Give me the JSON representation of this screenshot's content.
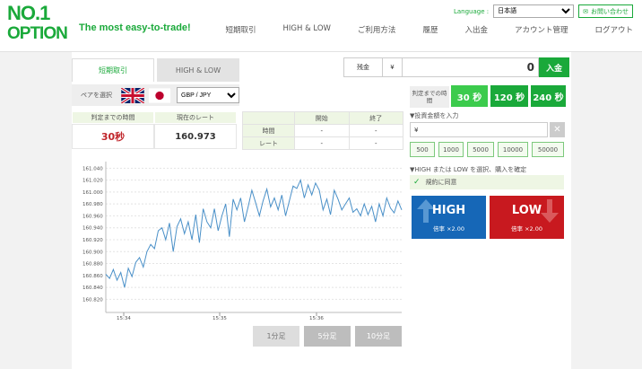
{
  "header": {
    "logo_line1": "NO.1",
    "logo_line2": "OPTION",
    "tagline": "The most easy-to-trade!",
    "language_label": "Language :",
    "language_value": "日本語",
    "contact_label": "お問い合わせ",
    "nav": [
      "短期取引",
      "HIGH & LOW",
      "ご利用方法",
      "履歴",
      "入出金",
      "アカウント管理",
      "ログアウト"
    ]
  },
  "tabs": {
    "short_term": "短期取引",
    "high_low": "HIGH & LOW"
  },
  "balance": {
    "label": "残金",
    "currency": "¥",
    "value": "0",
    "deposit_label": "入金"
  },
  "pair": {
    "label": "ペアを選択",
    "value": "GBP / JPY"
  },
  "stats": {
    "time_label": "判定までの時間",
    "rate_label": "現在のレート",
    "countdown": "30秒",
    "rate": "160.973"
  },
  "order_table": {
    "headers": [
      "",
      "開始",
      "終了"
    ],
    "rows": [
      [
        "時間",
        "-",
        "-"
      ],
      [
        "レート",
        "-",
        "-"
      ]
    ]
  },
  "chart_data": {
    "type": "line",
    "xlabel": "",
    "ylabel": "",
    "y_ticks": [
      "161.040",
      "161.020",
      "161.000",
      "160.980",
      "160.960",
      "160.940",
      "160.920",
      "160.900",
      "160.880",
      "160.860",
      "160.840",
      "160.820"
    ],
    "x_ticks": [
      "15:34",
      "15:35",
      "15:36"
    ],
    "ylim": [
      160.81,
      161.045
    ],
    "series": [
      {
        "values": [
          160.862,
          160.855,
          160.87,
          160.852,
          160.865,
          160.84,
          160.872,
          160.858,
          160.882,
          160.89,
          160.874,
          160.9,
          160.912,
          160.905,
          160.935,
          160.94,
          160.92,
          160.948,
          160.9,
          160.942,
          160.955,
          160.93,
          160.95,
          160.92,
          160.962,
          160.915,
          160.972,
          160.95,
          160.94,
          160.972,
          160.935,
          160.96,
          160.98,
          160.925,
          160.988,
          160.97,
          160.99,
          160.95,
          160.975,
          161.003,
          160.982,
          160.96,
          160.985,
          161.005,
          160.975,
          160.99,
          160.97,
          160.995,
          160.96,
          160.985,
          161.01,
          161.006,
          161.02,
          160.99,
          161.012,
          160.995,
          161.015,
          161.003,
          160.97,
          160.988,
          160.962,
          161.003,
          160.988,
          160.97,
          160.98,
          160.99,
          160.966,
          160.972,
          160.96,
          160.98,
          160.962,
          160.976,
          160.95,
          160.98,
          160.96,
          160.99,
          160.973,
          160.965,
          160.985,
          160.97
        ]
      }
    ]
  },
  "period_buttons": [
    "1分足",
    "5分足",
    "10分足"
  ],
  "time_select": {
    "label": "判定までの時間",
    "options": [
      "30 秒",
      "120 秒",
      "240 秒"
    ]
  },
  "amount": {
    "label": "▼投資金額を入力",
    "currency": "¥",
    "clear": "✕",
    "presets": [
      "500",
      "1000",
      "5000",
      "10000",
      "50000"
    ]
  },
  "hl_label": "▼HIGH または LOW を選択、購入を確定",
  "agree_label": "規約に同意",
  "high": {
    "label": "HIGH",
    "payout": "倍率 ×2.00"
  },
  "low": {
    "label": "LOW",
    "payout": "倍率 ×2.00"
  },
  "colors": {
    "brand": "#1aa93a",
    "high": "#1667b7",
    "low": "#c8191f"
  }
}
